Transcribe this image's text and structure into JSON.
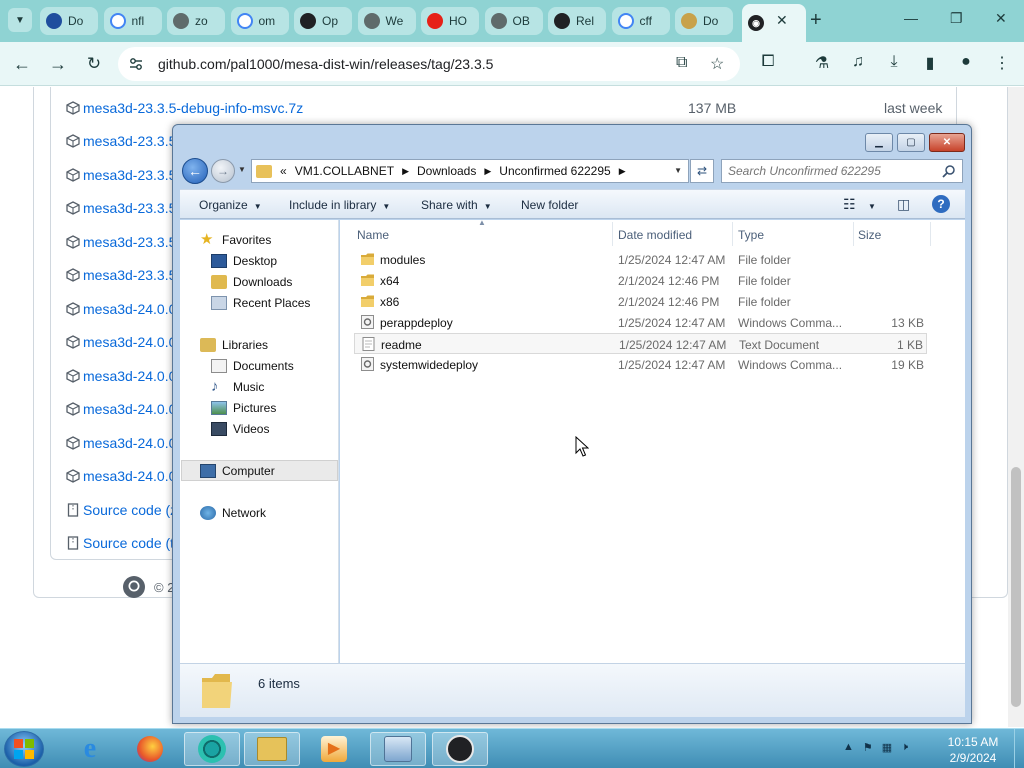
{
  "browser": {
    "tabs": [
      {
        "label": "Do",
        "icon": "ov-icon",
        "color": "#1f4e9e"
      },
      {
        "label": "nfl",
        "icon": "google-icon",
        "color": "#ffffff"
      },
      {
        "label": "zo",
        "icon": "generic-site-icon",
        "color": "#5f6b6b"
      },
      {
        "label": "om",
        "icon": "google-icon",
        "color": "#ffffff"
      },
      {
        "label": "Op",
        "icon": "openai-icon",
        "color": "#202124"
      },
      {
        "label": "We",
        "icon": "generic-site-icon",
        "color": "#5f6b6b"
      },
      {
        "label": "HO",
        "icon": "youtube-icon",
        "color": "#e62117"
      },
      {
        "label": "OB",
        "icon": "generic-site-icon",
        "color": "#5f6b6b"
      },
      {
        "label": "Rel",
        "icon": "github-icon",
        "color": "#202124"
      },
      {
        "label": "cff",
        "icon": "google-icon",
        "color": "#ffffff"
      },
      {
        "label": "Do",
        "icon": "puzzle-icon",
        "color": "#c8a24a"
      }
    ],
    "url": "github.com/pal1000/mesa-dist-win/releases/tag/23.3.5"
  },
  "github": {
    "assets": [
      {
        "name": "mesa3d-23.3.5-debug-info-msvc.7z",
        "size": "137 MB",
        "date": "last week"
      },
      {
        "name": "mesa3d-23.3.5"
      },
      {
        "name": "mesa3d-23.3.5"
      },
      {
        "name": "mesa3d-23.3.5"
      },
      {
        "name": "mesa3d-23.3.5"
      },
      {
        "name": "mesa3d-23.3.5"
      },
      {
        "name": "mesa3d-24.0.0"
      },
      {
        "name": "mesa3d-24.0.0"
      },
      {
        "name": "mesa3d-24.0.0"
      },
      {
        "name": "mesa3d-24.0.0"
      },
      {
        "name": "mesa3d-24.0.0"
      },
      {
        "name": "mesa3d-24.0.0"
      },
      {
        "name": "Source code (z"
      },
      {
        "name": "Source code (t"
      }
    ],
    "footer": "© 2"
  },
  "explorer": {
    "breadcrumb": [
      "«",
      "VM1.COLLABNET",
      "Downloads",
      "Unconfirmed 622295"
    ],
    "search_placeholder": "Search Unconfirmed 622295",
    "commands": [
      "Organize",
      "Include in library",
      "Share with",
      "New folder"
    ],
    "nav": {
      "favorites": "Favorites",
      "favorite_items": [
        "Desktop",
        "Downloads",
        "Recent Places"
      ],
      "libraries": "Libraries",
      "library_items": [
        "Documents",
        "Music",
        "Pictures",
        "Videos"
      ],
      "computer": "Computer",
      "network": "Network"
    },
    "columns": [
      "Name",
      "Date modified",
      "Type",
      "Size"
    ],
    "files": [
      {
        "name": "modules",
        "date": "1/25/2024 12:47 AM",
        "type": "File folder",
        "size": "",
        "kind": "folder"
      },
      {
        "name": "x64",
        "date": "2/1/2024 12:46 PM",
        "type": "File folder",
        "size": "",
        "kind": "folder"
      },
      {
        "name": "x86",
        "date": "2/1/2024 12:46 PM",
        "type": "File folder",
        "size": "",
        "kind": "folder"
      },
      {
        "name": "perappdeploy",
        "date": "1/25/2024 12:47 AM",
        "type": "Windows Comma...",
        "size": "13 KB",
        "kind": "cmd"
      },
      {
        "name": "readme",
        "date": "1/25/2024 12:47 AM",
        "type": "Text Document",
        "size": "1 KB",
        "kind": "text"
      },
      {
        "name": "systemwidedeploy",
        "date": "1/25/2024 12:47 AM",
        "type": "Windows Comma...",
        "size": "19 KB",
        "kind": "cmd"
      }
    ],
    "item_count": "6 items"
  },
  "taskbar": {
    "time": "10:15 AM",
    "date": "2/9/2024"
  },
  "colors": {
    "teal_frame": "#8fd3d3",
    "link_blue": "#0969da",
    "explorer_frame": "#bcd3ec"
  }
}
